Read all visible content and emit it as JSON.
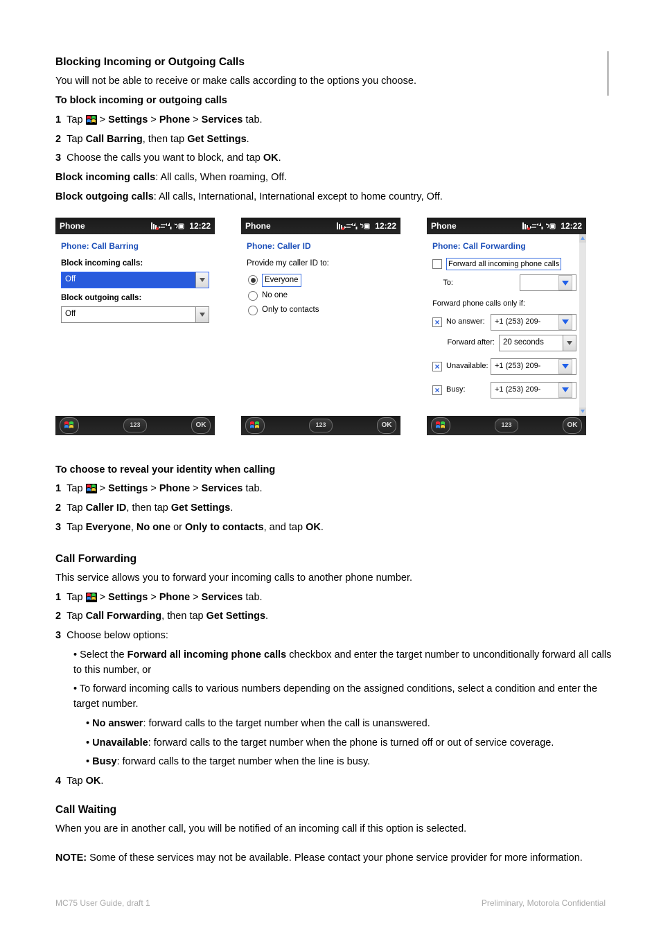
{
  "page": {
    "corner_decor": true,
    "section_a_title": "Blocking Incoming or Outgoing Calls",
    "section_a_text": "You will not be able to receive or make calls according to the options you choose.",
    "proc_block_title": "To block incoming or outgoing calls",
    "proc_block_steps": [
      {
        "num": "1",
        "segments": [
          {
            "t": "Tap "
          },
          {
            "icon": true
          },
          {
            "t": " > "
          },
          {
            "b": "Settings"
          },
          {
            "t": " > "
          },
          {
            "b": "Phone"
          },
          {
            "t": " > "
          },
          {
            "b": "Services"
          },
          {
            "t": " tab."
          }
        ]
      },
      {
        "num": "2",
        "segments": [
          {
            "t": "Tap "
          },
          {
            "b": "Call Barring"
          },
          {
            "t": ", then tap "
          },
          {
            "b": "Get Settings"
          },
          {
            "t": "."
          }
        ]
      },
      {
        "num": "3",
        "segments": [
          {
            "t": "Choose the calls you want to block, and tap "
          },
          {
            "b": "OK"
          },
          {
            "t": "."
          }
        ]
      }
    ],
    "block_incoming_label": "Block incoming calls",
    "block_incoming_sub": ": All calls, When roaming, Off.",
    "block_outgoing_label": "Block outgoing calls",
    "block_outgoing_sub": ": All calls, International, International except to home country, Off.",
    "figures_row": {
      "time": "12:22",
      "title": "Phone",
      "ok": "OK",
      "kbd": "123",
      "s1": {
        "subtitle": "Phone: Call Barring",
        "lbl_in": "Block incoming calls:",
        "val_in": "Off",
        "lbl_out": "Block outgoing calls:",
        "val_out": "Off"
      },
      "s2": {
        "subtitle": "Phone: Caller ID",
        "prompt": "Provide my caller ID to:",
        "opt1": "Everyone",
        "opt2": "No one",
        "opt3": "Only to contacts"
      },
      "s3": {
        "subtitle": "Phone: Call Forwarding",
        "fwd_all_label": "Forward all incoming phone calls",
        "to_label": "To:",
        "onlyif_label": "Forward phone calls only if:",
        "noanswer": "No answer:",
        "fwd_after": "Forward after:",
        "after_val": "20 seconds",
        "unavail": "Unavailable:",
        "busy": "Busy:",
        "num": "+1 (253) 209-"
      }
    },
    "section_b_title": "To choose to reveal your identity when calling",
    "section_b_steps": [
      {
        "num": "1",
        "segments": [
          {
            "t": "Tap "
          },
          {
            "icon": true
          },
          {
            "t": " > "
          },
          {
            "b": "Settings"
          },
          {
            "t": " > "
          },
          {
            "b": "Phone"
          },
          {
            "t": " > "
          },
          {
            "b": "Services"
          },
          {
            "t": " tab."
          }
        ]
      },
      {
        "num": "2",
        "segments": [
          {
            "t": "Tap "
          },
          {
            "b": "Caller ID"
          },
          {
            "t": ", then tap "
          },
          {
            "b": "Get Settings"
          },
          {
            "t": "."
          }
        ]
      },
      {
        "num": "3",
        "segments": [
          {
            "t": "Tap "
          },
          {
            "b": "Everyone"
          },
          {
            "t": ", "
          },
          {
            "b": "No one"
          },
          {
            "t": " or "
          },
          {
            "b": "Only to contacts"
          },
          {
            "t": ", and tap "
          },
          {
            "b": "OK"
          },
          {
            "t": "."
          }
        ]
      }
    ],
    "section_c_title": "Call Forwarding",
    "section_c_text": "This service allows you to forward your incoming calls to another phone number.",
    "section_c_steps": [
      {
        "num": "1",
        "segments": [
          {
            "t": "Tap "
          },
          {
            "icon": true
          },
          {
            "t": " > "
          },
          {
            "b": "Settings"
          },
          {
            "t": " > "
          },
          {
            "b": "Phone"
          },
          {
            "t": " > "
          },
          {
            "b": "Services"
          },
          {
            "t": " tab."
          }
        ]
      },
      {
        "num": "2",
        "segments": [
          {
            "t": "Tap "
          },
          {
            "b": "Call Forwarding"
          },
          {
            "t": ", then tap "
          },
          {
            "b": "Get Settings"
          },
          {
            "t": "."
          }
        ]
      },
      {
        "num": "3",
        "segments": [
          {
            "t": "Choose below options:"
          }
        ]
      }
    ],
    "section_c_opts": [
      {
        "pre": "Select the ",
        "b": "Forward all incoming phone calls",
        "post": " checkbox and enter the target number to unconditionally forward all calls to this number, or"
      },
      {
        "pre": "To forward incoming calls to various numbers depending on the assigned conditions, select a condition and enter the target number.",
        "bullets": [
          {
            "b": "No answer",
            "post": ": forward calls to the target number when the call is unanswered."
          },
          {
            "b": "Unavailable",
            "post": ": forward calls to the target number when the phone is turned off or out of service coverage."
          },
          {
            "b": "Busy",
            "post": ": forward calls to the target number when the line is busy."
          }
        ]
      }
    ],
    "section_c_tail_num": "4",
    "section_c_tail_segments": [
      {
        "t": "Tap "
      },
      {
        "b": "OK"
      },
      {
        "t": "."
      }
    ],
    "section_d_title": "Call Waiting",
    "section_d_text": "When you are in another call, you will be notified of an incoming call if this option is selected.",
    "note_label": "NOTE:",
    "note_text": "Some of these services may not be available. Please contact your phone service provider for more information.",
    "footer_left": "MC75 User Guide, draft 1",
    "footer_right": "Preliminary, Motorola Confidential"
  }
}
